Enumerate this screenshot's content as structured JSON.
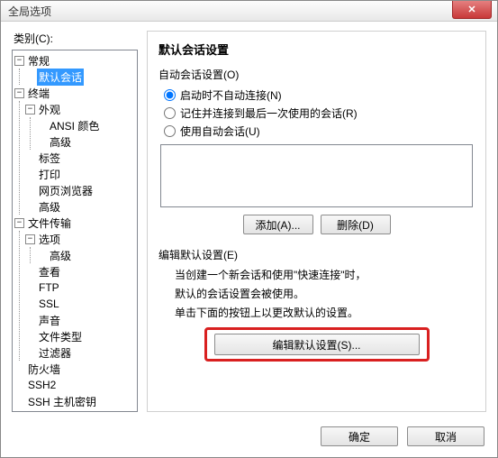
{
  "window": {
    "title": "全局选项"
  },
  "closeBtn": {
    "name": "close"
  },
  "categoryLabel": "类别(C):",
  "tree": {
    "general": "常规",
    "defaultSession": "默认会话",
    "terminal": "终端",
    "appearance": "外观",
    "ansiColor": "ANSI 颜色",
    "advanced": "高级",
    "tabs": "标签",
    "print": "打印",
    "webBrowser": "网页浏览器",
    "advanced2": "高级",
    "fileTransfer": "文件传输",
    "options": "选项",
    "advanced3": "高级",
    "view": "查看",
    "ftp": "FTP",
    "ssl": "SSL",
    "sound": "声音",
    "fileTypes": "文件类型",
    "filters": "过滤器",
    "firewall": "防火墙",
    "ssh2": "SSH2",
    "sshHostKeys": "SSH 主机密钥"
  },
  "panel": {
    "title": "默认会话设置",
    "autoSessionLabel": "自动会话设置(O)",
    "radio1": "启动时不自动连接(N)",
    "radio2": "记住并连接到最后一次使用的会话(R)",
    "radio3": "使用自动会话(U)",
    "addBtn": "添加(A)...",
    "deleteBtn": "删除(D)",
    "editDefaultLabel": "编辑默认设置(E)",
    "desc1": "当创建一个新会话和使用\"快速连接\"时，",
    "desc2": "默认的会话设置会被使用。",
    "desc3": "单击下面的按钮上以更改默认的设置。",
    "editBtn": "编辑默认设置(S)..."
  },
  "footer": {
    "ok": "确定",
    "cancel": "取消"
  },
  "toggle": {
    "minus": "−",
    "plus": "+"
  }
}
